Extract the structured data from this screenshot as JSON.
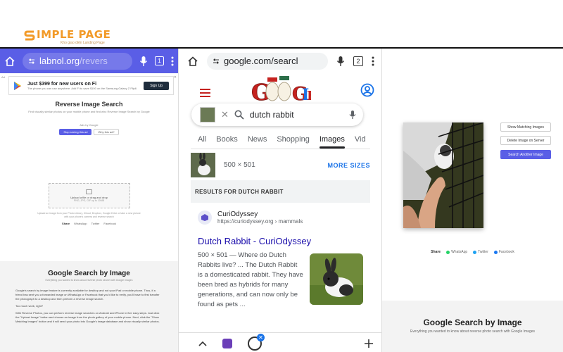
{
  "logo": {
    "text": "IMPLE PAGE",
    "sub": "Kho giao diện Landing Page",
    "color": "#f29a28"
  },
  "panel1": {
    "url": "labnol.org",
    "url_path": "/revers",
    "tab_count": "1",
    "ad": {
      "tag": "Ad",
      "title": "Just $399 for new users on Fi",
      "body": "The phone you can use anywhere. Add Fi to save $100 on the Samsung Galaxy Z Flip6",
      "cta": "Sign Up"
    },
    "title": "Reverse Image Search",
    "subtitle": "Find visually similar photos on your mobile phone and find who Reverse Image Search by Google",
    "ads_by": "Ads by Google",
    "ad_btn_primary": "Stop seeing this ad",
    "ad_btn_secondary": "Why this ad?",
    "drop_title": "Upload a file or drag and drop",
    "drop_formats": "PNG, JPG, GIF up to 10MB",
    "drop_hint": "Upload an image from your Photo Library, iCloud, Dropbox, Google Drive or take a new picture with your phone's camera and reverse search",
    "share_label": "Share",
    "share_items": [
      "WhatsApp",
      "Twitter",
      "Facebook"
    ],
    "section_title": "Google Search by Image",
    "section_sub": "Everything you wanted to know about reverse photo search with Google Images",
    "para1": "Google's search by image feature is currently available for desktop and not your iPad or mobile phone. Thus, if a friend has sent you a forwarded image on WhatsApp or Facebook that you'd like to verify, you'll have to first transfer the photograph to a desktop and then perform a reverse image search.",
    "para2": "Too much work, right?",
    "para3": "With Reverse Photos, you can perform reverse image searches on Android and iPhone in five easy steps. Just click the \"Upload Image\" button and choose an image from the photo gallery of your mobile phone. Next, click the \"Show Matching Images\" button and it will send your photo into Google's image database and show visually similar photos."
  },
  "panel2": {
    "url": "google.com/searcl",
    "tab_count": "2",
    "query": "dutch rabbit",
    "tabs": [
      "All",
      "Books",
      "News",
      "Shopping",
      "Images",
      "Vid"
    ],
    "active_tab": "Images",
    "image_dims": "500 × 501",
    "more_sizes": "MORE SIZES",
    "results_header": "RESULTS FOR DUTCH RABBIT",
    "result": {
      "site_name": "CuriOdyssey",
      "site_url": "https://curiodyssey.org › mammals",
      "title": "Dutch Rabbit - CuriOdyssey",
      "snippet": "500 × 501 — Where do Dutch Rabbits live? ... The Dutch Rabbit is a domesticated rabbit. They have been bred as hybrids for many generations, and can now only be found as pets ..."
    }
  },
  "panel3": {
    "btn_show": "Show Matching Images",
    "btn_delete": "Delete Image on Server",
    "btn_search": "Search Another Image",
    "share_label": "Share",
    "share_items": [
      "WhatsApp",
      "Twitter",
      "Facebook"
    ],
    "section_title": "Google Search by Image",
    "section_sub": "Everything you wanted to know about reverse photo search with Google Images",
    "accent": "#5a5ee6"
  }
}
